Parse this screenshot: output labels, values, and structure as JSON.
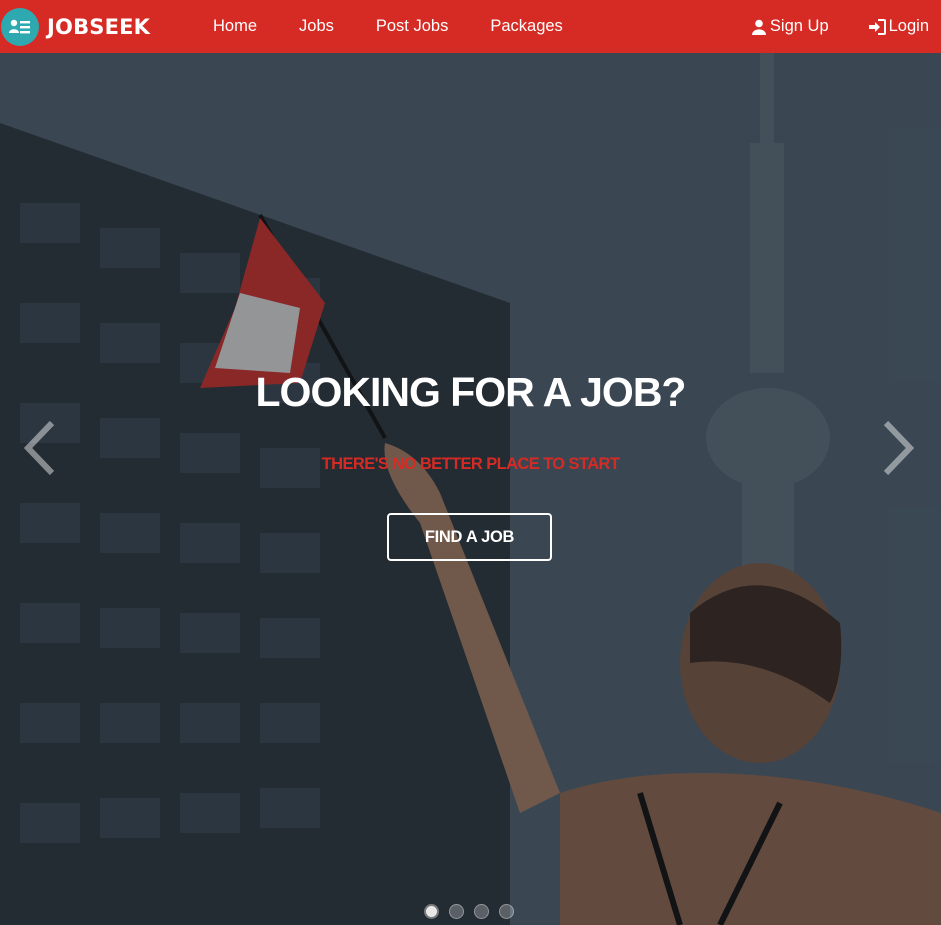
{
  "brand": {
    "name": "JOBSEEK",
    "logo_icon": "user-list-icon",
    "logo_color": "#2fa9b0"
  },
  "nav": {
    "items": [
      {
        "label": "Home"
      },
      {
        "label": "Jobs"
      },
      {
        "label": "Post Jobs"
      },
      {
        "label": "Packages"
      }
    ],
    "sign_up": {
      "label": "Sign Up",
      "icon": "user-icon"
    },
    "login": {
      "label": "Login",
      "icon": "login-icon"
    }
  },
  "hero": {
    "title": "LOOKING FOR A JOB?",
    "subtitle": "THERE'S NO BETTER PLACE TO START",
    "cta_label": "FIND A JOB",
    "prev_icon": "chevron-left-icon",
    "next_icon": "chevron-right-icon",
    "slides_count": 4,
    "active_slide": 1
  },
  "colors": {
    "brand_red": "#d62b24",
    "accent_teal": "#2fa9b0",
    "text_white": "#ffffff"
  }
}
